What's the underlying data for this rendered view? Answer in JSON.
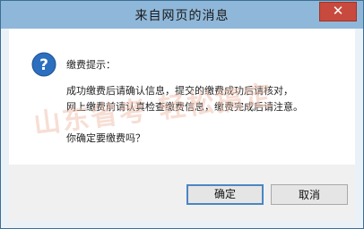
{
  "window": {
    "title": "来自网页的消息",
    "close_glyph": "✕"
  },
  "message": {
    "icon": "info-question-icon",
    "heading": "缴费提示：",
    "line1": "成功缴费后请确认信息，提交的缴费成功后请核对，",
    "line2": "网上缴费前请认真检查缴费信息，缴费完成后请注意。",
    "line3": "你确定要缴费吗？"
  },
  "watermark": {
    "text": "山东省考 轻松搞定"
  },
  "buttons": {
    "ok_label": "确定",
    "cancel_label": "取消"
  },
  "colors": {
    "titlebar": "#8fb7d9",
    "close": "#c84a3e",
    "accent": "#4a86c5"
  }
}
